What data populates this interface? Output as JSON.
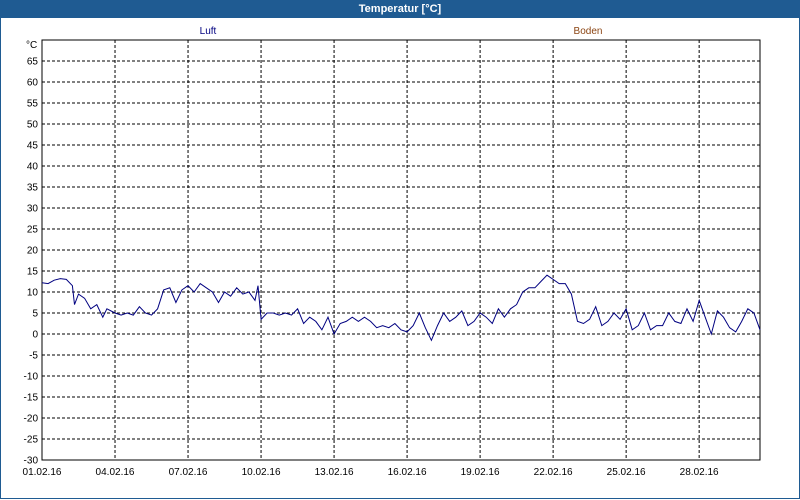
{
  "window": {
    "title": "Temperatur [°C]"
  },
  "colors": {
    "titlebar": "#1f5b92",
    "luft": "#000080",
    "boden": "#8b4513",
    "grid": "#000000"
  },
  "chart_data": {
    "type": "line",
    "title": "Temperatur [°C]",
    "ylabel": "°C",
    "ylim": [
      -30,
      70
    ],
    "xlim": [
      "01.02.16",
      "01.03.16 12:00"
    ],
    "yticks": [
      "65",
      "60",
      "55",
      "50",
      "45",
      "40",
      "35",
      "30",
      "25",
      "20",
      "15",
      "10",
      "5",
      "0",
      "-5",
      "-10",
      "-15",
      "-20",
      "-25",
      "-30"
    ],
    "xticks": [
      "01.02.16",
      "04.02.16",
      "07.02.16",
      "10.02.16",
      "13.02.16",
      "16.02.16",
      "19.02.16",
      "22.02.16",
      "25.02.16",
      "28.02.16"
    ],
    "grid": true,
    "legend": [
      "Luft",
      "Boden"
    ],
    "series": [
      {
        "name": "Luft",
        "color": "#000080",
        "points": [
          [
            "01.02.16 00:00",
            12.2
          ],
          [
            "01.02.16 06:00",
            12.0
          ],
          [
            "01.02.16 12:00",
            12.8
          ],
          [
            "01.02.16 18:00",
            13.2
          ],
          [
            "02.02.16 00:00",
            13.0
          ],
          [
            "02.02.16 06:00",
            11.5
          ],
          [
            "02.02.16 08:00",
            7.0
          ],
          [
            "02.02.16 12:00",
            9.5
          ],
          [
            "02.02.16 18:00",
            8.5
          ],
          [
            "03.02.16 00:00",
            6.0
          ],
          [
            "03.02.16 06:00",
            7.0
          ],
          [
            "03.02.16 12:00",
            4.0
          ],
          [
            "03.02.16 16:00",
            6.0
          ],
          [
            "04.02.16 00:00",
            5.0
          ],
          [
            "04.02.16 06:00",
            4.5
          ],
          [
            "04.02.16 12:00",
            5.0
          ],
          [
            "04.02.16 18:00",
            4.5
          ],
          [
            "05.02.16 00:00",
            6.5
          ],
          [
            "05.02.16 06:00",
            5.0
          ],
          [
            "05.02.16 12:00",
            4.5
          ],
          [
            "05.02.16 18:00",
            6.0
          ],
          [
            "06.02.16 00:00",
            10.5
          ],
          [
            "06.02.16 06:00",
            11.0
          ],
          [
            "06.02.16 12:00",
            7.5
          ],
          [
            "06.02.16 18:00",
            10.5
          ],
          [
            "07.02.16 00:00",
            11.5
          ],
          [
            "07.02.16 06:00",
            10.0
          ],
          [
            "07.02.16 12:00",
            12.0
          ],
          [
            "07.02.16 18:00",
            11.0
          ],
          [
            "08.02.16 00:00",
            10.0
          ],
          [
            "08.02.16 06:00",
            7.5
          ],
          [
            "08.02.16 12:00",
            10.0
          ],
          [
            "08.02.16 18:00",
            9.0
          ],
          [
            "09.02.16 00:00",
            11.0
          ],
          [
            "09.02.16 06:00",
            9.5
          ],
          [
            "09.02.16 12:00",
            10.0
          ],
          [
            "09.02.16 18:00",
            8.0
          ],
          [
            "09.02.16 21:00",
            11.5
          ],
          [
            "10.02.16 00:00",
            3.5
          ],
          [
            "10.02.16 06:00",
            5.0
          ],
          [
            "10.02.16 12:00",
            5.0
          ],
          [
            "10.02.16 18:00",
            4.5
          ],
          [
            "11.02.16 00:00",
            5.0
          ],
          [
            "11.02.16 06:00",
            4.5
          ],
          [
            "11.02.16 12:00",
            6.0
          ],
          [
            "11.02.16 18:00",
            2.5
          ],
          [
            "12.02.16 00:00",
            4.0
          ],
          [
            "12.02.16 06:00",
            3.0
          ],
          [
            "12.02.16 12:00",
            1.0
          ],
          [
            "12.02.16 18:00",
            4.0
          ],
          [
            "13.02.16 00:00",
            0.0
          ],
          [
            "13.02.16 06:00",
            2.5
          ],
          [
            "13.02.16 12:00",
            3.0
          ],
          [
            "13.02.16 18:00",
            4.0
          ],
          [
            "14.02.16 00:00",
            3.0
          ],
          [
            "14.02.16 06:00",
            4.0
          ],
          [
            "14.02.16 12:00",
            3.0
          ],
          [
            "14.02.16 18:00",
            1.5
          ],
          [
            "15.02.16 00:00",
            2.0
          ],
          [
            "15.02.16 06:00",
            1.5
          ],
          [
            "15.02.16 12:00",
            2.5
          ],
          [
            "15.02.16 18:00",
            1.0
          ],
          [
            "16.02.16 00:00",
            0.5
          ],
          [
            "16.02.16 06:00",
            2.0
          ],
          [
            "16.02.16 12:00",
            5.0
          ],
          [
            "16.02.16 18:00",
            1.5
          ],
          [
            "17.02.16 00:00",
            -1.5
          ],
          [
            "17.02.16 06:00",
            2.0
          ],
          [
            "17.02.16 12:00",
            5.0
          ],
          [
            "17.02.16 18:00",
            3.0
          ],
          [
            "18.02.16 00:00",
            4.0
          ],
          [
            "18.02.16 06:00",
            5.5
          ],
          [
            "18.02.16 12:00",
            2.0
          ],
          [
            "18.02.16 18:00",
            3.0
          ],
          [
            "19.02.16 00:00",
            5.0
          ],
          [
            "19.02.16 06:00",
            4.0
          ],
          [
            "19.02.16 12:00",
            2.5
          ],
          [
            "19.02.16 18:00",
            6.0
          ],
          [
            "20.02.16 00:00",
            4.0
          ],
          [
            "20.02.16 06:00",
            6.0
          ],
          [
            "20.02.16 12:00",
            7.0
          ],
          [
            "20.02.16 18:00",
            10.0
          ],
          [
            "21.02.16 00:00",
            11.0
          ],
          [
            "21.02.16 06:00",
            11.0
          ],
          [
            "21.02.16 12:00",
            12.5
          ],
          [
            "21.02.16 18:00",
            14.0
          ],
          [
            "22.02.16 00:00",
            13.0
          ],
          [
            "22.02.16 06:00",
            12.0
          ],
          [
            "22.02.16 12:00",
            12.0
          ],
          [
            "22.02.16 18:00",
            9.5
          ],
          [
            "23.02.16 00:00",
            3.0
          ],
          [
            "23.02.16 06:00",
            2.5
          ],
          [
            "23.02.16 12:00",
            3.5
          ],
          [
            "23.02.16 18:00",
            6.5
          ],
          [
            "24.02.16 00:00",
            2.0
          ],
          [
            "24.02.16 06:00",
            3.0
          ],
          [
            "24.02.16 12:00",
            5.0
          ],
          [
            "24.02.16 18:00",
            3.5
          ],
          [
            "25.02.16 00:00",
            6.0
          ],
          [
            "25.02.16 06:00",
            1.0
          ],
          [
            "25.02.16 12:00",
            2.0
          ],
          [
            "25.02.16 18:00",
            5.0
          ],
          [
            "26.02.16 00:00",
            1.0
          ],
          [
            "26.02.16 06:00",
            2.0
          ],
          [
            "26.02.16 12:00",
            2.0
          ],
          [
            "26.02.16 18:00",
            5.0
          ],
          [
            "27.02.16 00:00",
            3.0
          ],
          [
            "27.02.16 06:00",
            2.5
          ],
          [
            "27.02.16 12:00",
            6.0
          ],
          [
            "27.02.16 18:00",
            3.0
          ],
          [
            "28.02.16 00:00",
            8.0
          ],
          [
            "28.02.16 06:00",
            4.0
          ],
          [
            "28.02.16 12:00",
            0.0
          ],
          [
            "28.02.16 18:00",
            5.5
          ],
          [
            "29.02.16 00:00",
            4.0
          ],
          [
            "29.02.16 06:00",
            1.5
          ],
          [
            "29.02.16 12:00",
            0.5
          ],
          [
            "29.02.16 18:00",
            3.0
          ],
          [
            "01.03.16 00:00",
            6.0
          ],
          [
            "01.03.16 06:00",
            5.0
          ],
          [
            "01.03.16 12:00",
            1.0
          ]
        ]
      },
      {
        "name": "Boden",
        "color": "#8b4513",
        "points": []
      }
    ]
  }
}
